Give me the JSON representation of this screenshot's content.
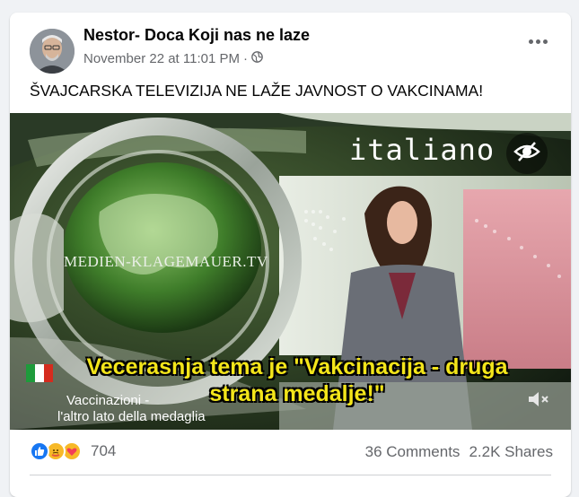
{
  "post": {
    "author": "Nestor- Doca Koji nas ne laze",
    "timestamp": "November 22 at 11:01 PM",
    "separator": "·",
    "privacy_icon": "globe-icon",
    "text": "ŠVAJCARSKA TELEVIZIJA NE LAŽE JAVNOST O VAKCINAMA!"
  },
  "video": {
    "channel_logo": "MEDIEN-KLAGEMAUER.TV",
    "language_label": "italiano",
    "caption_line1": "Vecerasnja tema je \"Vakcinacija - druga",
    "caption_line2": "strana medalje!\"",
    "italian_subtitle_line1": "Vaccinazioni -",
    "italian_subtitle_line2": "l'altro lato della medaglia",
    "hide_icon": "eye-slash-icon",
    "mute_icon": "speaker-muted-icon"
  },
  "footer": {
    "reactions": [
      "like",
      "care",
      "love"
    ],
    "reaction_count": "704",
    "comments": "36 Comments",
    "shares": "2.2K Shares"
  },
  "colors": {
    "like": "#1877f2",
    "caption": "#f3e51a",
    "secondary_text": "#65676b"
  }
}
